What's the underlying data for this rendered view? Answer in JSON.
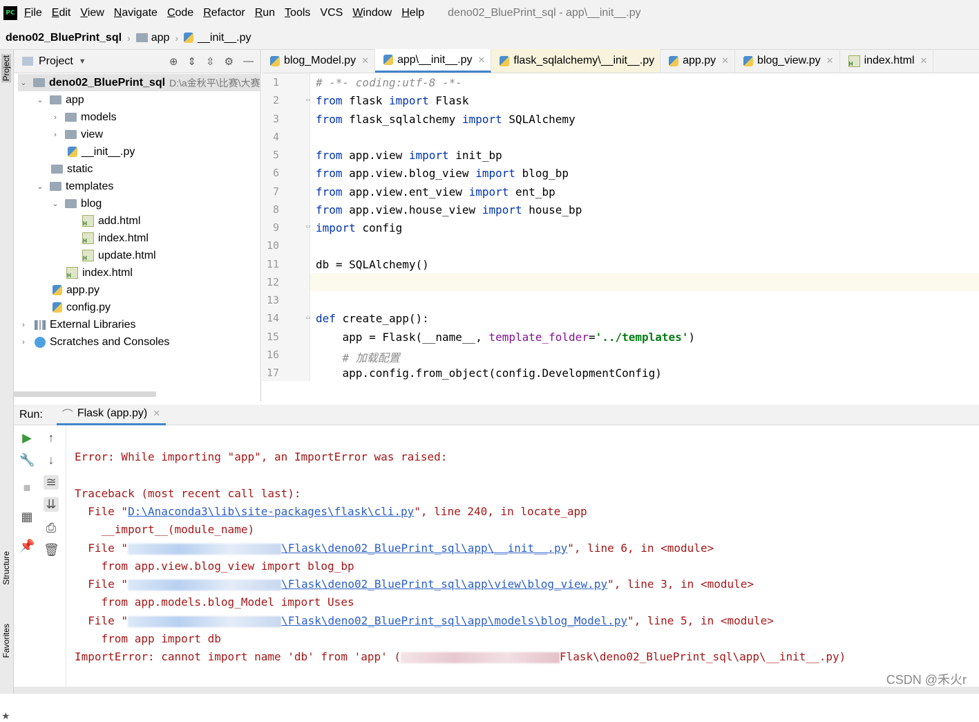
{
  "menubar": {
    "items": [
      {
        "label": "File",
        "u": "F",
        "rest": "ile"
      },
      {
        "label": "Edit",
        "u": "E",
        "rest": "dit"
      },
      {
        "label": "View",
        "u": "V",
        "rest": "iew"
      },
      {
        "label": "Navigate",
        "u": "N",
        "rest": "avigate"
      },
      {
        "label": "Code",
        "u": "C",
        "rest": "ode"
      },
      {
        "label": "Refactor",
        "u": "R",
        "rest": "efactor"
      },
      {
        "label": "Run",
        "u": "R",
        "rest": "un"
      },
      {
        "label": "Tools",
        "u": "T",
        "rest": "ools"
      },
      {
        "label": "VCS",
        "u": "",
        "rest": "VCS"
      },
      {
        "label": "Window",
        "u": "W",
        "rest": "indow"
      },
      {
        "label": "Help",
        "u": "H",
        "rest": "elp"
      }
    ],
    "window_title": "deno02_BluePrint_sql - app\\__init__.py",
    "logo": "PC"
  },
  "breadcrumb": [
    "deno02_BluePrint_sql",
    "app",
    "__init__.py"
  ],
  "left_strip": {
    "project_label": "Project",
    "structure_label": "Structure",
    "favorites_label": "Favorites"
  },
  "project_panel": {
    "title": "Project",
    "root": {
      "name": "deno02_BluePrint_sql",
      "path": "D:\\a金秋平\\比赛\\大赛"
    },
    "nodes": {
      "app": "app",
      "models": "models",
      "view": "view",
      "init": "__init__.py",
      "static": "static",
      "templates": "templates",
      "blog": "blog",
      "add": "add.html",
      "index_blog": "index.html",
      "update": "update.html",
      "index": "index.html",
      "app_py": "app.py",
      "config": "config.py",
      "ext_libs": "External Libraries",
      "scratches": "Scratches and Consoles"
    }
  },
  "editor_tabs": [
    "blog_Model.py",
    "app\\__init__.py",
    "flask_sqlalchemy\\__init__.py",
    "app.py",
    "blog_view.py",
    "index.html"
  ],
  "editor": {
    "line_numbers": [
      "1",
      "2",
      "3",
      "4",
      "5",
      "6",
      "7",
      "8",
      "9",
      "10",
      "11",
      "12",
      "13",
      "14",
      "15",
      "16",
      "17"
    ],
    "lines": {
      "l1": "# -*- coding:utf-8 -*-",
      "kw_from": "from",
      "kw_import": "import",
      "kw_def": "def",
      "l2_mod": " flask ",
      "l2_name": " Flask",
      "l3_mod": " flask_sqlalchemy ",
      "l3_name": " SQLAlchemy",
      "l5_mod": " app.view ",
      "l5_name": " init_bp",
      "l6_mod": " app.view.blog_view ",
      "l6_name": " blog_bp",
      "l7_mod": " app.view.ent_view ",
      "l7_name": " ent_bp",
      "l8_mod": " app.view.house_view ",
      "l8_name": " house_bp",
      "l9_name": " config",
      "l11": "db = SQLAlchemy()",
      "l14": " create_app():",
      "l15_a": "    app = Flask(__name__, ",
      "l15_param": "template_folder",
      "l15_eq": "=",
      "l15_str": "'../templates'",
      "l15_end": ")",
      "l16": "    # 加载配置",
      "l17": "    app.config.from_object(config.DevelopmentConfig)"
    }
  },
  "run_panel": {
    "label": "Run:",
    "tab": "Flask (app.py)",
    "console": {
      "c1": "Error: While importing \"app\", an ImportError was raised:",
      "c2": "Traceback (most recent call last):",
      "c3_pre": "  File \"",
      "c3_link": "D:\\Anaconda3\\lib\\site-packages\\flask\\cli.py",
      "c3_post": "\", line 240, in locate_app",
      "c4": "    __import__(module_name)",
      "c5_pre": "  File \"",
      "c5_link": "\\Flask\\deno02_BluePrint_sql\\app\\__init__.py",
      "c5_post": "\", line 6, in <module>",
      "c6": "    from app.view.blog_view import blog_bp",
      "c7_pre": "  File \"",
      "c7_link": "\\Flask\\deno02_BluePrint_sql\\app\\view\\blog_view.py",
      "c7_post": "\", line 3, in <module>",
      "c8": "    from app.models.blog_Model import Uses",
      "c9_pre": "  File \"",
      "c9_link": "\\Flask\\deno02_BluePrint_sql\\app\\models\\blog_Model.py",
      "c9_post": "\", line 5, in <module>",
      "c10": "    from app import db",
      "c11_pre": "ImportError: cannot import name 'db' from 'app' (",
      "c11_post": "Flask\\deno02_BluePrint_sql\\app\\__init__.py)"
    }
  },
  "watermark": "CSDN @禾火r"
}
